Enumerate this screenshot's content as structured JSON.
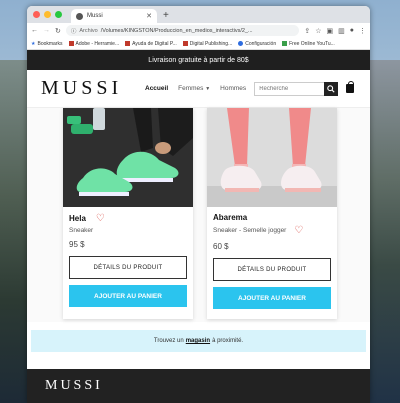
{
  "browser": {
    "tab_title": "Mussi",
    "tab_close": "✕",
    "new_tab": "+",
    "url_scheme": "Archivo",
    "url": "/Volumes/KINGSTON/Produccion_en_medios_interactivs/2_...",
    "bookmarks_label": "Bookmarks",
    "bookmarks": [
      "Adobe - Herramie...",
      "Ayuda de Digital P...",
      "Digital Publishing...",
      "Configuración",
      "Free Online YouTu..."
    ]
  },
  "promo": {
    "text": "Livraison gratuite à partir de 80$"
  },
  "header": {
    "logo": "MUSSI",
    "nav": {
      "home": "Accueil",
      "women": "Femmes",
      "men": "Hommes"
    },
    "search_placeholder": "Recherche"
  },
  "products": [
    {
      "name": "Hela",
      "subtitle": "Sneaker",
      "price": "95 $",
      "details_label": "DÉTAILS DU PRODUIT",
      "cart_label": "AJOUTER AU PANIER"
    },
    {
      "name": "Abarema",
      "subtitle": "Sneaker - Semelle jogger",
      "price": "60 $",
      "details_label": "DÉTAILS DU PRODUIT",
      "cart_label": "AJOUTER AU PANIER"
    }
  ],
  "store_finder": {
    "before": "Trouvez un",
    "link": "magasin",
    "after": "à proximité."
  },
  "footer": {
    "logo": "MUSSI"
  },
  "colors": {
    "accent": "#2bc4ee",
    "dark": "#1f1f1f",
    "heart": "#d6453d",
    "store_bg": "#d7f3fb"
  }
}
